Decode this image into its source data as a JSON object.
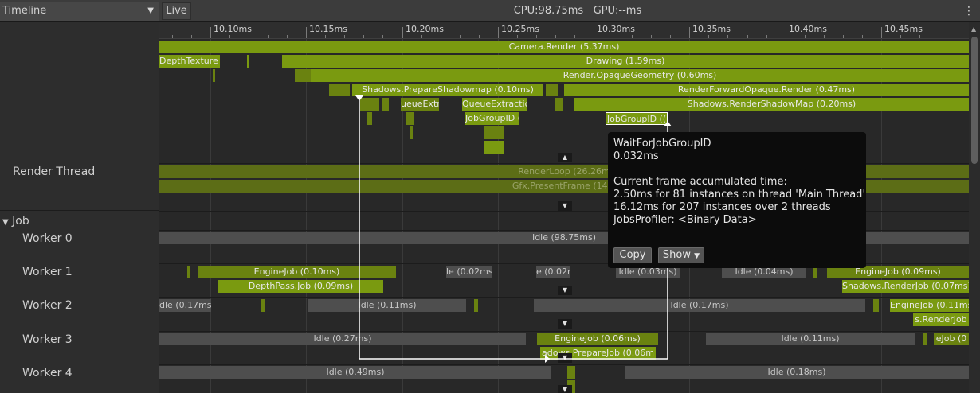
{
  "toolbar": {
    "view_select": "Timeline",
    "live_label": "Live",
    "cpu_label": "CPU:98.75ms",
    "gpu_label": "GPU:--ms"
  },
  "ruler": {
    "ticks": [
      "10.10ms",
      "10.15ms",
      "10.20ms",
      "10.25ms",
      "10.30ms",
      "10.35ms",
      "10.40ms",
      "10.45ms"
    ]
  },
  "threads": {
    "render_thread": "Render Thread",
    "job_group": "Job",
    "workers": [
      "Worker 0",
      "Worker 1",
      "Worker 2",
      "Worker 3",
      "Worker 4"
    ]
  },
  "main_thread": {
    "camera_render": "Camera.Render (5.37ms)",
    "depth_texture": "DepthTexture (",
    "drawing": "Drawing (1.59ms)",
    "render_opaque": "Render.OpaqueGeometry (0.60ms)",
    "shadows_prepare": "Shadows.PrepareShadowmap (0.10ms)",
    "render_forward": "RenderForwardOpaque.Render (0.47ms)",
    "queue_extr_a": "ueueExtr",
    "queue_extr_b": "QueueExtractio",
    "shadows_render": "Shadows.RenderShadowMap (0.20ms)",
    "job_group_a": "JobGroupID (",
    "job_group_b": "JobGroupID (("
  },
  "render_thread": {
    "render_loop": "RenderLoop (26.26m",
    "present_frame": "Gfx.PresentFrame (14.4"
  },
  "worker0": {
    "idle": "Idle (98.75ms)"
  },
  "worker1": {
    "engine_job_a": "EngineJob (0.10ms)",
    "depth_pass": "DepthPass.Job (0.09ms)",
    "idle_a": "le (0.02ms",
    "idle_b": "e (0.02n",
    "idle_c": "Idle (0.03ms)",
    "idle_d": "Idle (0.04ms)",
    "engine_job_b": "EngineJob (0.09ms)",
    "shadows_job": "Shadows.RenderJob (0.07ms)"
  },
  "worker2": {
    "idle_a": "dle (0.17ms)",
    "idle_b": "Idle (0.11ms)",
    "idle_c": "Idle (0.17ms)",
    "engine_job": "EngineJob (0.11ms",
    "render_job": "s.RenderJob"
  },
  "worker3": {
    "idle_a": "Idle (0.27ms)",
    "engine_job_a": "EngineJob (0.06ms)",
    "prepare_job": "adows.PrepareJob (0.06m",
    "idle_b": "Idle (0.11ms)",
    "engine_job_b": "eJob (0"
  },
  "worker4": {
    "idle_a": "Idle (0.49ms)",
    "idle_b": "Idle (0.18ms)"
  },
  "tooltip": {
    "name": "WaitForJobGroupID",
    "duration": "0.032ms",
    "accum_title": "Current frame accumulated time:",
    "line1": "2.50ms for 81 instances on thread 'Main Thread'",
    "line2": "16.12ms for 207 instances over 2 threads",
    "line3": "JobsProfiler: <Binary Data>",
    "copy_button": "Copy",
    "show_button": "Show"
  },
  "colors": {
    "job_green": "#7a9a10",
    "idle_gray": "#4e4e4e",
    "background": "#282828"
  }
}
